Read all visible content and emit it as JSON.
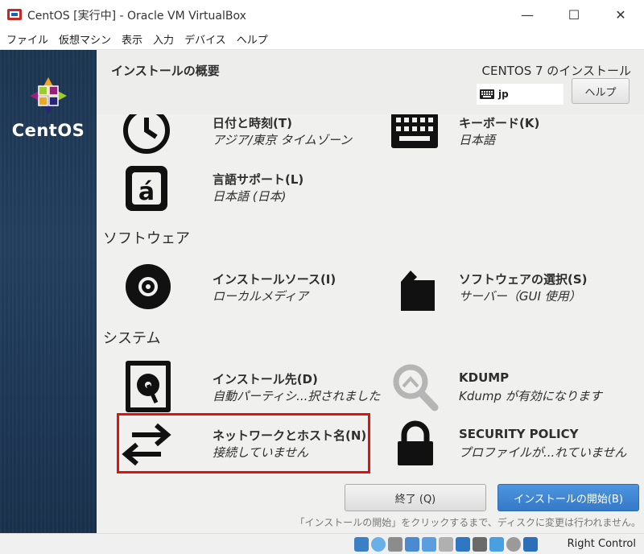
{
  "window": {
    "title": "CentOS [実行中] - Oracle VM VirtualBox",
    "minimize_glyph": "—",
    "maximize_glyph": "☐",
    "close_glyph": "✕"
  },
  "menu": [
    "ファイル",
    "仮想マシン",
    "表示",
    "入力",
    "デバイス",
    "ヘルプ"
  ],
  "brand": {
    "logo_text": "CentOS"
  },
  "header": {
    "page_title": "インストールの概要",
    "install_title": "CENTOS 7 のインストール",
    "keyboard_layout": "jp",
    "help_label": "ヘルプ"
  },
  "sections": {
    "software": "ソフトウェア",
    "system": "システム"
  },
  "spokes": {
    "datetime": {
      "title": "日付と時刻(T)",
      "status": "アジア/東京 タイムゾーン"
    },
    "keyboard": {
      "title": "キーボード(K)",
      "status": "日本語"
    },
    "language": {
      "title": "言語サポート(L)",
      "status": "日本語 (日本)"
    },
    "source": {
      "title": "インストールソース(I)",
      "status": "ローカルメディア"
    },
    "software_selection": {
      "title": "ソフトウェアの選択(S)",
      "status": "サーバー（GUI 使用）"
    },
    "destination": {
      "title": "インストール先(D)",
      "status": "自動パーティシ...択されました"
    },
    "kdump": {
      "title": "KDUMP",
      "status": "Kdump が有効になります"
    },
    "network": {
      "title": "ネットワークとホスト名(N)",
      "status": "接続していません"
    },
    "security": {
      "title": "SECURITY POLICY",
      "status": "プロファイルが...れていません"
    }
  },
  "buttons": {
    "quit": "終了 (Q)",
    "begin": "インストールの開始(B)"
  },
  "footer_note": "「インストールの開始」をクリックするまで、ディスクに変更は行われません。",
  "statusbar": {
    "host_key": "Right Control"
  },
  "colors": {
    "accent": "#3a7fcc",
    "highlight": "#e21010",
    "sidebar": "#1d3a58"
  }
}
